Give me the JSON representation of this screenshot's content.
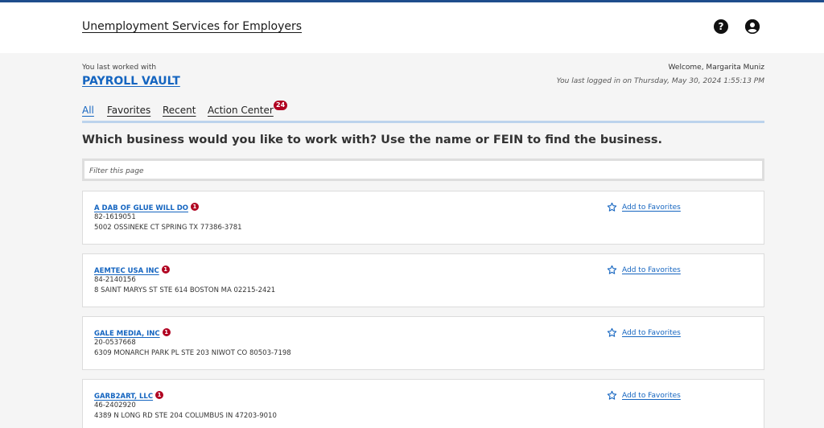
{
  "header": {
    "app_title": "Unemployment Services for Employers",
    "help_icon": "question-circle-icon",
    "user_icon": "user-circle-icon"
  },
  "context": {
    "last_worked_label": "You last worked with",
    "last_worked_business": "PAYROLL VAULT",
    "welcome_text": "Welcome, Margarita Muniz",
    "last_login_text": "You last logged in on Thursday, May 30, 2024 1:55:13 PM"
  },
  "tabs": {
    "all": "All",
    "favorites": "Favorites",
    "recent": "Recent",
    "action_center": "Action Center",
    "action_center_count": "24"
  },
  "main": {
    "question": "Which business would you like to work with? Use the name or FEIN to find the business.",
    "filter_placeholder": "Filter this page"
  },
  "businesses": [
    {
      "name": "A DAB OF GLUE WILL DO",
      "alert_count": "1",
      "fein": "82-1619051",
      "address": "5002 OSSINEKE CT SPRING TX 77386-3781",
      "favorite_label": "Add to Favorites"
    },
    {
      "name": "AEMTEC USA INC",
      "alert_count": "1",
      "fein": "84-2140156",
      "address": "8 SAINT MARYS ST STE 614 BOSTON MA 02215-2421",
      "favorite_label": "Add to Favorites"
    },
    {
      "name": "GALE MEDIA, INC",
      "alert_count": "1",
      "fein": "20-0537668",
      "address": "6309 MONARCH PARK PL STE 203 NIWOT CO 80503-7198",
      "favorite_label": "Add to Favorites"
    },
    {
      "name": "GARB2ART, LLC",
      "alert_count": "1",
      "fein": "46-2402920",
      "address": "4389 N LONG RD STE 204 COLUMBUS IN 47203-9010",
      "favorite_label": "Add to Favorites"
    }
  ],
  "colors": {
    "accent": "#1565c0",
    "alert": "#b00020",
    "top_bar": "#1e4d8c"
  }
}
